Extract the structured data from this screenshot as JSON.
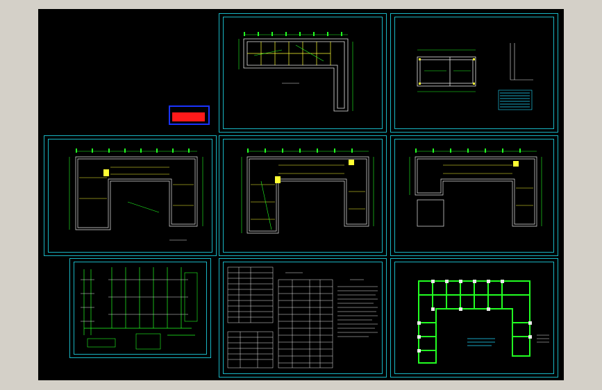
{
  "viewer": {
    "background": "#d4d0c8",
    "canvas_color": "#000000",
    "frame_color": "#19b6c4"
  },
  "stamp": {
    "border_color": "#1a33ff",
    "text_color": "#ff2020"
  },
  "sheets": [
    {
      "name": "sheet-site-plan",
      "kind": "plan"
    },
    {
      "name": "sheet-detail",
      "kind": "detail"
    },
    {
      "name": "sheet-first-floor-plan",
      "kind": "plan"
    },
    {
      "name": "sheet-second-floor-plan",
      "kind": "plan"
    },
    {
      "name": "sheet-third-floor-plan",
      "kind": "plan"
    },
    {
      "name": "sheet-system-diagram",
      "kind": "diagram"
    },
    {
      "name": "sheet-schedule-notes",
      "kind": "table"
    },
    {
      "name": "sheet-foundation-plan",
      "kind": "plan"
    }
  ]
}
